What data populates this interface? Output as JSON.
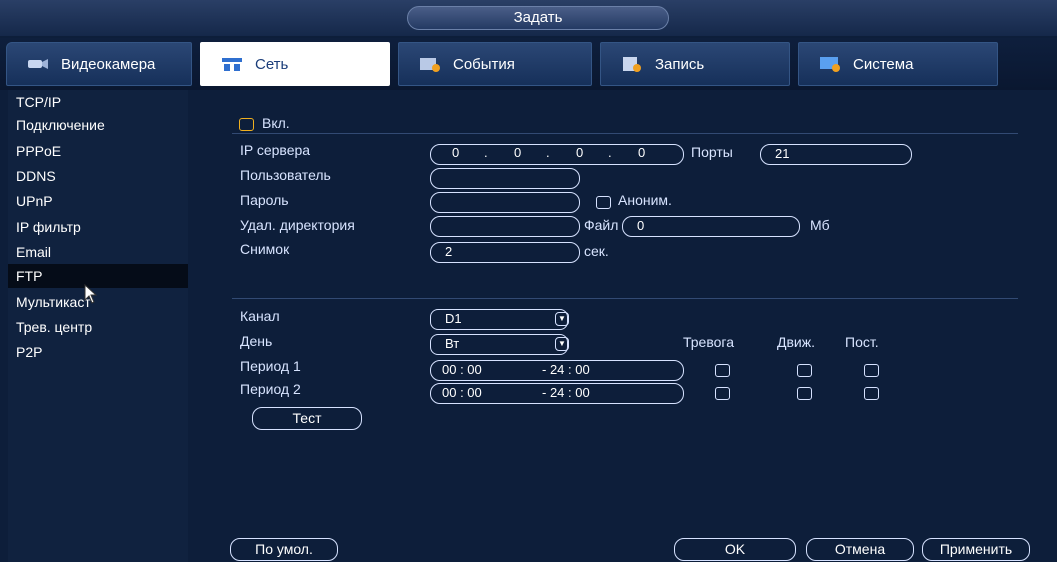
{
  "window": {
    "title": "Задать"
  },
  "tabs": [
    {
      "label": "Видеокамера",
      "icon": "camera-icon"
    },
    {
      "label": "Сеть",
      "icon": "network-icon",
      "active": true
    },
    {
      "label": "События",
      "icon": "events-icon"
    },
    {
      "label": "Запись",
      "icon": "record-icon"
    },
    {
      "label": "Система",
      "icon": "system-icon"
    }
  ],
  "sidebar": {
    "items": [
      "TCP/IP",
      "Подключение",
      "PPPoE",
      "DDNS",
      "UPnP",
      "IP фильтр",
      "Email",
      "FTP",
      "Мультикаст",
      "Трев. центр",
      "P2P"
    ],
    "active": "FTP"
  },
  "ftp": {
    "enable_label": "Вкл.",
    "server_ip_label": "IP сервера",
    "ip_octets": [
      "0",
      "0",
      "0",
      "0"
    ],
    "ip_sep": ".",
    "port_label": "Порты",
    "port_value": "21",
    "user_label": "Пользователь",
    "user_value": "",
    "password_label": "Пароль",
    "password_value": "",
    "anon_label": "Аноним.",
    "remote_dir_label": "Удал. директория",
    "remote_dir_value": "",
    "file_label": "Файл",
    "file_value": "0",
    "file_unit": "Мб",
    "snapshot_label": "Снимок",
    "snapshot_value": "2",
    "snapshot_unit": "сек."
  },
  "schedule": {
    "channel_label": "Канал",
    "channel_value": "D1",
    "day_label": "День",
    "day_value": "Вт",
    "col_alarm": "Тревога",
    "col_motion": "Движ.",
    "col_const": "Пост.",
    "periods": [
      {
        "label": "Период 1",
        "start": "00 : 00",
        "end": "- 24 : 00"
      },
      {
        "label": "Период 2",
        "start": "00 : 00",
        "end": "- 24 : 00"
      }
    ],
    "test_label": "Тест"
  },
  "footer": {
    "default_label": "По умол.",
    "ok_label": "OK",
    "cancel_label": "Отмена",
    "apply_label": "Применить"
  },
  "colors": {
    "background": "#0d1e3a",
    "active_tab": "#ffffff",
    "checkbox_accent": "#f0b020"
  }
}
